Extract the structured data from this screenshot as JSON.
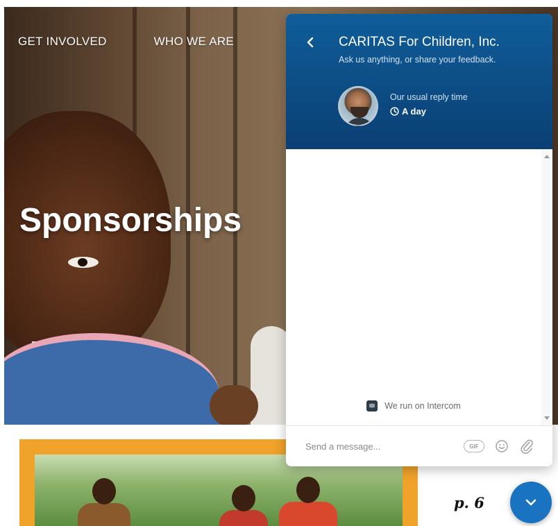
{
  "site": {
    "nav": [
      {
        "label": "GET INVOLVED"
      },
      {
        "label": "WHO WE ARE"
      }
    ],
    "hero_title": "Sponsorships",
    "page_number": "p. 6"
  },
  "messenger": {
    "back_icon": "chevron-left-icon",
    "team_name": "CARITAS For Children, Inc.",
    "team_intro": "Ask us anything, or share your feedback.",
    "reply_label": "Our usual reply time",
    "reply_time": "A day",
    "branding": "We run on Intercom",
    "composer": {
      "placeholder": "Send a message...",
      "gif_label": "GIF"
    },
    "colors": {
      "header_top": "#0f5d9a",
      "header_bottom": "#0a3f73",
      "launcher": "#1a73c0"
    }
  },
  "colors": {
    "frame_orange": "#f0a32a"
  }
}
